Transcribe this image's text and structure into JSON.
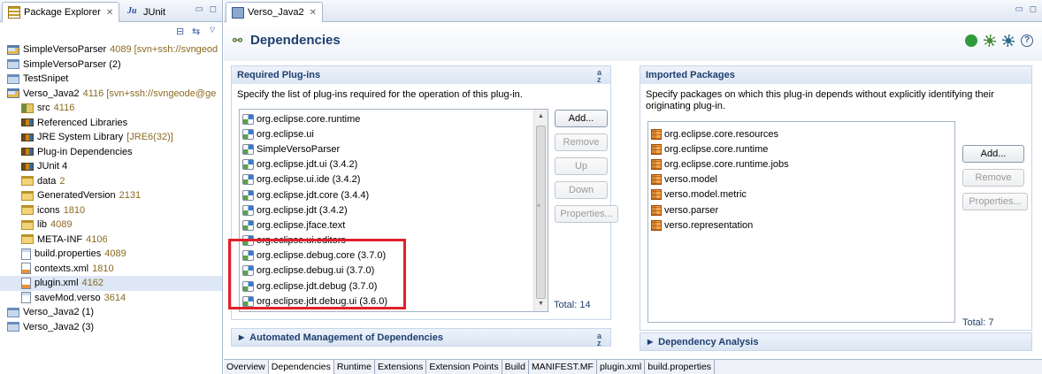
{
  "explorer": {
    "tabs": [
      {
        "label": "Package Explorer",
        "close": "✕"
      },
      {
        "label": "JUnit",
        "prefix": "Ju"
      }
    ],
    "window_buttons": "▭ ◻",
    "tree": [
      {
        "label": "SimpleVersoParser",
        "deco": "4089 [svn+ssh://svngeod",
        "icon": "project-svn-icon",
        "level": 0
      },
      {
        "label": "SimpleVersoParser (2)",
        "deco": "",
        "icon": "project-icon",
        "level": 0
      },
      {
        "label": "TestSnipet",
        "deco": "",
        "icon": "project-icon",
        "level": 0
      },
      {
        "label": "Verso_Java2",
        "deco": "4116 [svn+ssh://svngeode@ge",
        "icon": "project-svn-icon",
        "level": 0
      },
      {
        "label": "src",
        "deco": "4116",
        "icon": "source-folder-icon",
        "level": 1
      },
      {
        "label": "Referenced Libraries",
        "deco": "",
        "icon": "library-icon",
        "level": 1
      },
      {
        "label": "JRE System Library",
        "deco": "[JRE6(32)]",
        "icon": "library-icon",
        "level": 1
      },
      {
        "label": "Plug-in Dependencies",
        "deco": "",
        "icon": "library-icon",
        "level": 1
      },
      {
        "label": "JUnit 4",
        "deco": "",
        "icon": "library-icon",
        "level": 1
      },
      {
        "label": "data",
        "deco": "2",
        "icon": "folder-icon",
        "level": 1
      },
      {
        "label": "GeneratedVersion",
        "deco": "2131",
        "icon": "folder-icon",
        "level": 1
      },
      {
        "label": "icons",
        "deco": "1810",
        "icon": "folder-icon",
        "level": 1
      },
      {
        "label": "lib",
        "deco": "4089",
        "icon": "folder-icon",
        "level": 1
      },
      {
        "label": "META-INF",
        "deco": "4106",
        "icon": "folder-icon",
        "level": 1
      },
      {
        "label": "build.properties",
        "deco": "4089",
        "icon": "file-icon",
        "level": 1
      },
      {
        "label": "contexts.xml",
        "deco": "1810",
        "icon": "xml-file-icon",
        "level": 1
      },
      {
        "label": "plugin.xml",
        "deco": "4162",
        "icon": "xml-file-icon",
        "level": 1,
        "selected": true
      },
      {
        "label": "saveMod.verso",
        "deco": "3614",
        "icon": "file-icon",
        "level": 1
      },
      {
        "label": "Verso_Java2 (1)",
        "deco": "",
        "icon": "project-icon",
        "level": 0
      },
      {
        "label": "Verso_Java2 (3)",
        "deco": "",
        "icon": "project-icon",
        "level": 0
      }
    ]
  },
  "editor": {
    "tab_label": "Verso_Java2",
    "tab_close": "✕",
    "window_buttons": "▭ ◻",
    "page_title": "Dependencies",
    "required": {
      "title": "Required Plug-ins",
      "description": "Specify the list of plug-ins required for the operation of this plug-in.",
      "items": [
        "org.eclipse.core.runtime",
        "org.eclipse.ui",
        "SimpleVersoParser",
        "org.eclipse.jdt.ui (3.4.2)",
        "org.eclipse.ui.ide (3.4.2)",
        "org.eclipse.jdt.core (3.4.4)",
        "org.eclipse.jdt (3.4.2)",
        "org.eclipse.jface.text",
        "org.eclipse.ui.editors",
        "org.eclipse.debug.core (3.7.0)",
        "org.eclipse.debug.ui (3.7.0)",
        "org.eclipse.jdt.debug (3.7.0)",
        "org.eclipse.jdt.debug.ui (3.6.0)"
      ],
      "buttons": {
        "add": "Add...",
        "remove": "Remove",
        "up": "Up",
        "down": "Down",
        "properties": "Properties..."
      },
      "total": "Total: 14"
    },
    "imported": {
      "title": "Imported Packages",
      "description": "Specify packages on which this plug-in depends without explicitly identifying their originating plug-in.",
      "items": [
        "org.eclipse.core.resources",
        "org.eclipse.core.runtime",
        "org.eclipse.core.runtime.jobs",
        "verso.model",
        "verso.model.metric",
        "verso.parser",
        "verso.representation"
      ],
      "buttons": {
        "add": "Add...",
        "remove": "Remove",
        "properties": "Properties..."
      },
      "total": "Total: 7"
    },
    "automated": {
      "title": "Automated Management of Dependencies"
    },
    "analysis": {
      "title": "Dependency Analysis"
    },
    "sort_icon": "a z",
    "bottom_tabs": [
      "Overview",
      "Dependencies",
      "Runtime",
      "Extensions",
      "Extension Points",
      "Build",
      "MANIFEST.MF",
      "plugin.xml",
      "build.properties"
    ],
    "active_bottom_tab": "Dependencies"
  },
  "colors": {
    "highlight": "#e0202a",
    "section_title": "#1f3f6f",
    "decoration": "#8a6a20"
  }
}
